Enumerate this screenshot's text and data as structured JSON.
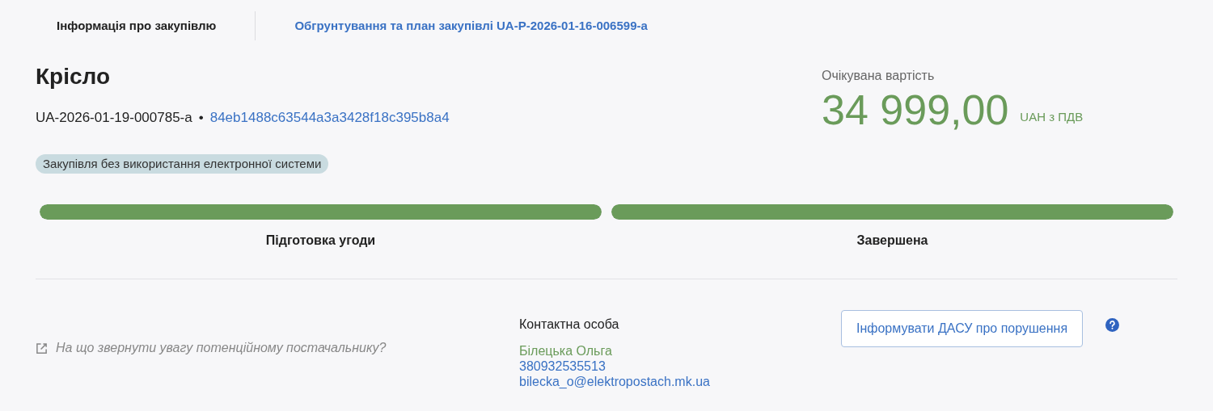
{
  "tabs": [
    {
      "label": "Інформація про закупівлю",
      "selected": true
    },
    {
      "label": "Обгрунтування та план закупівлі UA-P-2026-01-16-006599-a",
      "selected": false
    }
  ],
  "title": "Крісло",
  "tender_id": "UA-2026-01-19-000785-a",
  "separator": "•",
  "hash": "84eb1488c63544a3a3428f18c395b8a4",
  "badge": "Закупівля без використання електронної системи",
  "expected_value": {
    "label": "Очікувана вартість",
    "amount": "34 999,00",
    "currency": "UAH з ПДВ"
  },
  "stages": [
    {
      "label": "Підготовка угоди",
      "level": 1
    },
    {
      "label": "Завершена",
      "level": 1
    }
  ],
  "supplier_hint": "На що звернути увагу потенційному постачальнику?",
  "contact": {
    "heading": "Контактна особа",
    "name": "Білецька Ольга",
    "phone": "380932535513",
    "email": "bilecka_o@elektropostach.mk.ua"
  },
  "report_button": "Інформувати ДАСУ про порушення"
}
